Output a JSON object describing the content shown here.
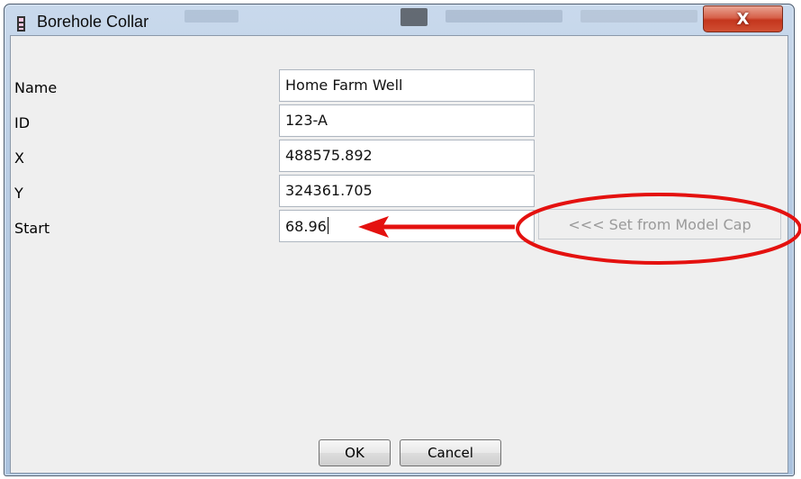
{
  "window": {
    "title": "Borehole Collar",
    "close_label": "X"
  },
  "fields": [
    {
      "label": "Name",
      "value": "Home Farm Well"
    },
    {
      "label": "ID",
      "value": "123-A"
    },
    {
      "label": "X",
      "value": "488575.892"
    },
    {
      "label": "Y",
      "value": "324361.705"
    },
    {
      "label": "Start",
      "value": "68.96"
    }
  ],
  "set_from_model_cap_label": "<<< Set from Model Cap",
  "buttons": {
    "ok": "OK",
    "cancel": "Cancel"
  },
  "colors": {
    "annotation": "#e4110f",
    "close_button": "#c4361d"
  },
  "icons": {
    "app": "document-icon",
    "close": "close-icon"
  }
}
